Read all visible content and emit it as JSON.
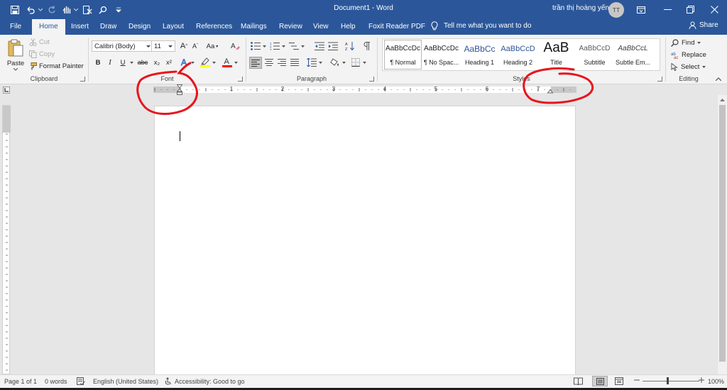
{
  "window": {
    "title": "Document1  -  Word",
    "user_name": "trần thị hoàng yến",
    "user_initials": "TT"
  },
  "tabs": [
    {
      "label": "File"
    },
    {
      "label": "Home"
    },
    {
      "label": "Insert"
    },
    {
      "label": "Draw"
    },
    {
      "label": "Design"
    },
    {
      "label": "Layout"
    },
    {
      "label": "References"
    },
    {
      "label": "Mailings"
    },
    {
      "label": "Review"
    },
    {
      "label": "View"
    },
    {
      "label": "Help"
    },
    {
      "label": "Foxit Reader PDF"
    }
  ],
  "active_tab": "Home",
  "tell_me": "Tell me what you want to do",
  "share_label": "Share",
  "clipboard": {
    "group_label": "Clipboard",
    "paste": "Paste",
    "cut": "Cut",
    "copy": "Copy",
    "format_painter": "Format Painter"
  },
  "font": {
    "group_label": "Font",
    "font_name": "Calibri (Body)",
    "font_size": "11",
    "bold": "B",
    "italic": "I",
    "underline": "U",
    "strikethrough": "abc",
    "subscript": "x₂",
    "superscript": "x²",
    "change_case": "Aa",
    "grow_font": "A",
    "shrink_font": "A"
  },
  "paragraph": {
    "group_label": "Paragraph"
  },
  "styles": {
    "group_label": "Styles",
    "items": [
      {
        "preview": "AaBbCcDc",
        "name": "¶ Normal"
      },
      {
        "preview": "AaBbCcDc",
        "name": "¶ No Spac..."
      },
      {
        "preview": "AaBbCc",
        "name": "Heading 1"
      },
      {
        "preview": "AaBbCcD",
        "name": "Heading 2"
      },
      {
        "preview": "AaB",
        "name": "Title"
      },
      {
        "preview": "AaBbCcD",
        "name": "Subtitle"
      },
      {
        "preview": "AaBbCcL",
        "name": "Subtle Em..."
      }
    ]
  },
  "editing": {
    "group_label": "Editing",
    "find": "Find",
    "replace": "Replace",
    "select": "Select"
  },
  "ruler": {
    "numbers": [
      "1",
      "2",
      "3",
      "4",
      "5",
      "6",
      "7"
    ]
  },
  "status": {
    "page": "Page 1 of 1",
    "words": "0 words",
    "language": "English (United States)",
    "accessibility": "Accessibility: Good to go",
    "zoom": "100%"
  },
  "colors": {
    "word_blue": "#2b579a",
    "ribbon_bg": "#f3f3f3",
    "annotation_red": "#e8141c",
    "highlight_yellow": "#ffff00",
    "font_color_red": "#ff0000"
  }
}
